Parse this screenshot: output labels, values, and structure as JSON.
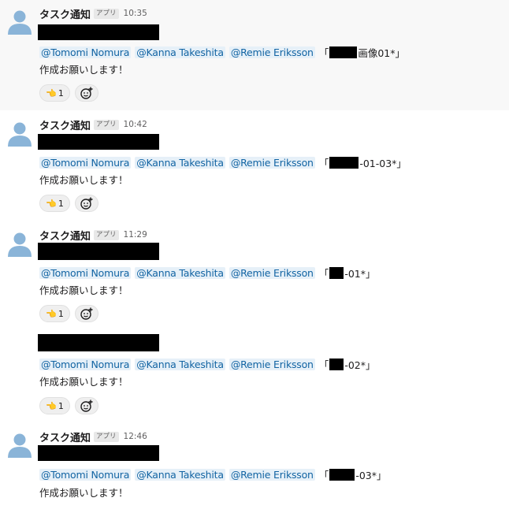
{
  "sender": "タスク通知",
  "app_label": "アプリ",
  "body_text": "作成お願いします！",
  "mentions": [
    "@Tomomi Nomura",
    "@Kanna Takeshita",
    "@Remie Eriksson"
  ],
  "bracket_open": "「",
  "bracket_close": "」",
  "reaction_count": "1",
  "reaction_emoji": "👈",
  "icons": {
    "avatar": "user-avatar-icon",
    "add_reaction": "add-reaction-icon"
  },
  "colors": {
    "mention_text": "#1264a3",
    "mention_bg": "#e6f0f8",
    "avatar": "#8ab4d8",
    "highlight": "#f8f8f8"
  },
  "messages": [
    {
      "time": "10:35",
      "ref": "画像01*」"
    },
    {
      "time": "10:42",
      "ref": "-01-03*」"
    },
    {
      "time": "11:29",
      "ref": "-01*」"
    },
    {
      "ref": "-02*」"
    },
    {
      "time": "12:46",
      "ref": "-03*」"
    }
  ]
}
